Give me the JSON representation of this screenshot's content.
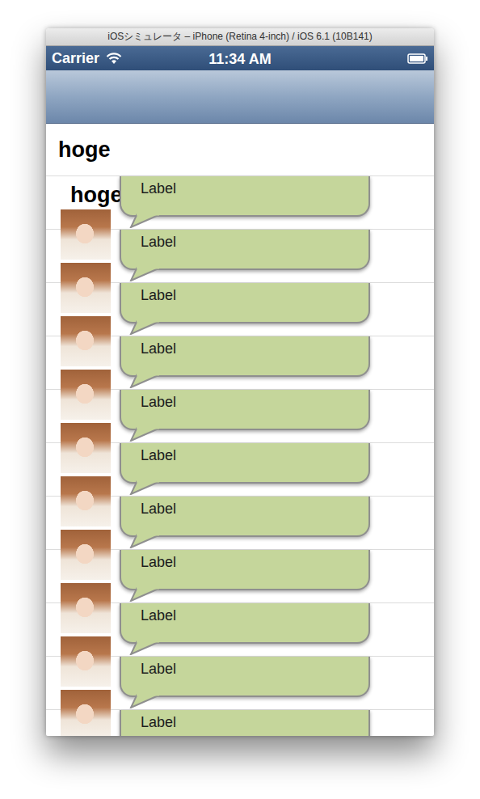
{
  "window": {
    "title": "iOSシミュレータ – iPhone (Retina 4-inch) / iOS 6.1 (10B141)"
  },
  "status_bar": {
    "carrier": "Carrier",
    "time": "11:34 AM"
  },
  "table": {
    "rows": [
      {
        "kind": "text",
        "title": "hoge"
      },
      {
        "kind": "message",
        "title": "hoge",
        "label": "Label"
      },
      {
        "kind": "message",
        "label": "Label"
      },
      {
        "kind": "message",
        "label": "Label"
      },
      {
        "kind": "message",
        "label": "Label"
      },
      {
        "kind": "message",
        "label": "Label"
      },
      {
        "kind": "message",
        "label": "Label"
      },
      {
        "kind": "message",
        "label": "Label"
      },
      {
        "kind": "message",
        "label": "Label"
      },
      {
        "kind": "message",
        "label": "Label"
      },
      {
        "kind": "message",
        "label": "Label"
      },
      {
        "kind": "message",
        "label": "Label"
      }
    ]
  }
}
